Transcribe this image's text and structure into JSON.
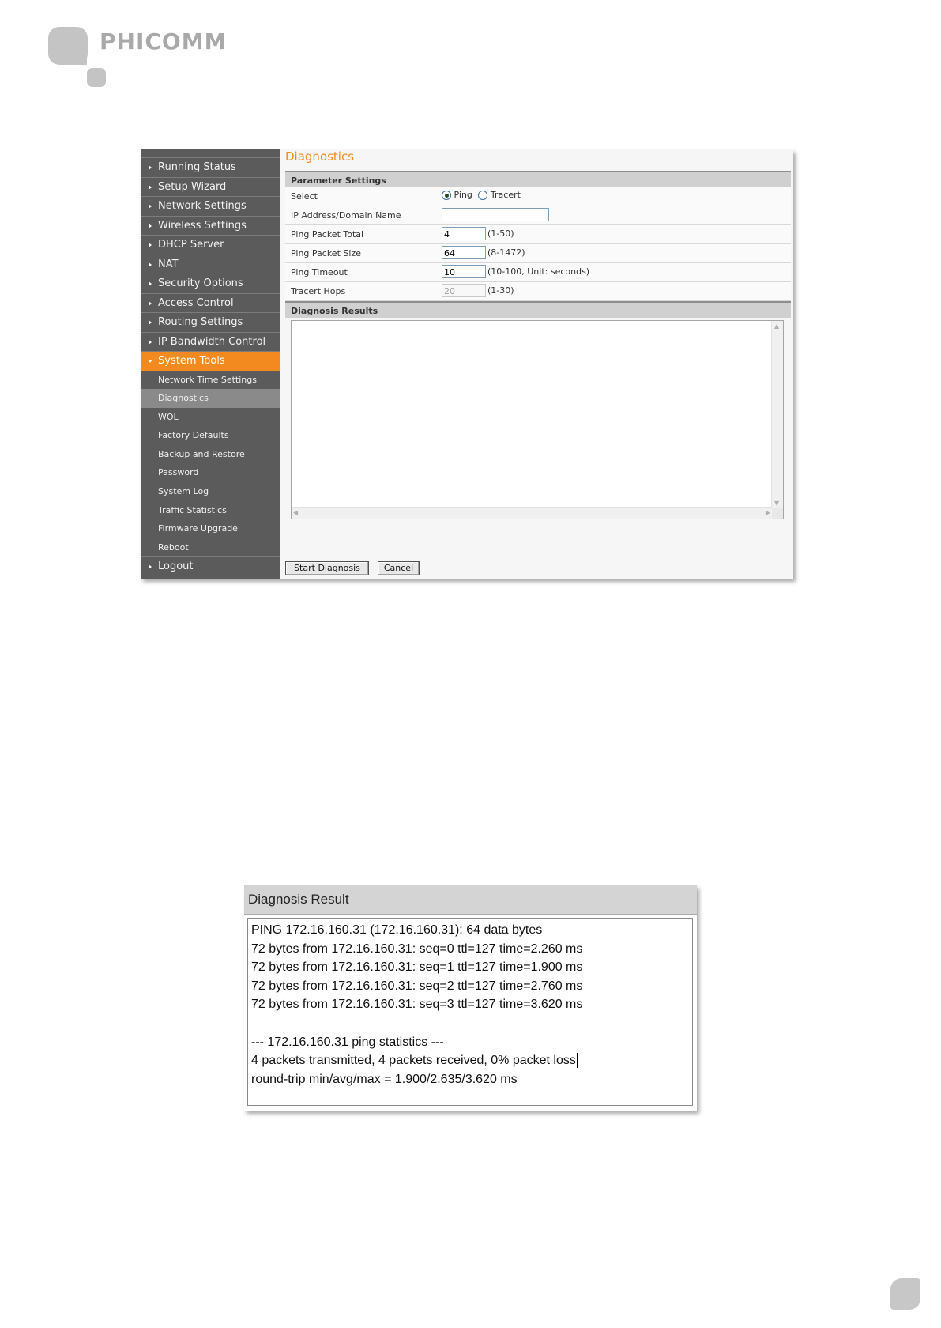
{
  "brand": {
    "name": "PHICOMM"
  },
  "sidebar": {
    "items_top": [
      {
        "label": "Running Status"
      },
      {
        "label": "Setup Wizard"
      },
      {
        "label": "Network Settings"
      },
      {
        "label": "Wireless Settings"
      },
      {
        "label": "DHCP Server"
      },
      {
        "label": "NAT"
      },
      {
        "label": "Security Options"
      },
      {
        "label": "Access Control"
      },
      {
        "label": "Routing Settings"
      },
      {
        "label": "IP Bandwidth Control"
      }
    ],
    "active": {
      "label": "System Tools"
    },
    "subitems": [
      {
        "label": "Network Time Settings"
      },
      {
        "label": "Diagnostics"
      },
      {
        "label": "WOL"
      },
      {
        "label": "Factory Defaults"
      },
      {
        "label": "Backup and Restore"
      },
      {
        "label": "Password"
      },
      {
        "label": "System Log"
      },
      {
        "label": "Traffic Statistics"
      },
      {
        "label": "Firmware Upgrade"
      },
      {
        "label": "Reboot"
      }
    ],
    "logout": {
      "label": "Logout"
    }
  },
  "main": {
    "title": "Diagnostics",
    "param_header": "Parameter Settings",
    "select": {
      "label": "Select",
      "opt_ping": "Ping",
      "opt_tracert": "Tracert",
      "selected": "Ping"
    },
    "ip": {
      "label": "IP Address/Domain Name",
      "value": ""
    },
    "packet_total": {
      "label": "Ping Packet Total",
      "value": "4",
      "hint": "(1-50)"
    },
    "packet_size": {
      "label": "Ping Packet Size",
      "value": "64",
      "hint": "(8-1472)"
    },
    "timeout": {
      "label": "Ping Timeout",
      "value": "10",
      "hint": "(10-100, Unit: seconds)"
    },
    "hops": {
      "label": "Tracert Hops",
      "value": "20",
      "hint": "(1-30)"
    },
    "results_header": "Diagnosis Results",
    "buttons": {
      "start": "Start Diagnosis",
      "cancel": "Cancel"
    }
  },
  "result_panel": {
    "title": "Diagnosis Result",
    "lines": [
      "PING 172.16.160.31 (172.16.160.31): 64 data bytes",
      "72 bytes from 172.16.160.31: seq=0 ttl=127 time=2.260 ms",
      "72 bytes from 172.16.160.31: seq=1 ttl=127 time=1.900 ms",
      "72 bytes from 172.16.160.31: seq=2 ttl=127 time=2.760 ms",
      "72 bytes from 172.16.160.31: seq=3 ttl=127 time=3.620 ms",
      "",
      "--- 172.16.160.31 ping statistics ---",
      "4 packets transmitted, 4 packets received, 0% packet loss",
      "round-trip min/avg/max = 1.900/2.635/3.620 ms"
    ]
  },
  "colors": {
    "accent": "#f38a1f",
    "sidebar": "#5b5b5b",
    "logo": "#c4c4c4"
  }
}
